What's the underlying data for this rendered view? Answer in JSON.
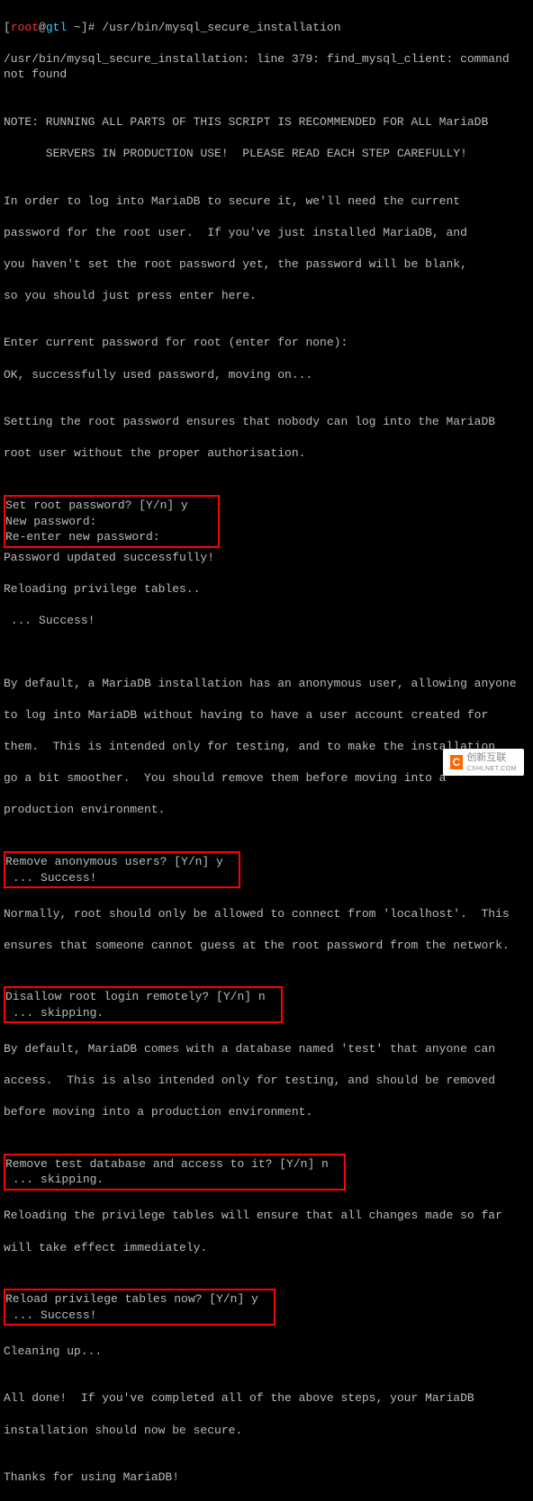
{
  "prompt": {
    "user": "root",
    "at": "@",
    "host": "gtl",
    "path": " ~",
    "suffix": "]# ",
    "command": "/usr/bin/mysql_secure_installation"
  },
  "lines": {
    "l01": "/usr/bin/mysql_secure_installation: line 379: find_mysql_client: command not found",
    "l02": "",
    "l03": "NOTE: RUNNING ALL PARTS OF THIS SCRIPT IS RECOMMENDED FOR ALL MariaDB",
    "l04": "      SERVERS IN PRODUCTION USE!  PLEASE READ EACH STEP CAREFULLY!",
    "l05": "",
    "l06": "In order to log into MariaDB to secure it, we'll need the current",
    "l07": "password for the root user.  If you've just installed MariaDB, and",
    "l08": "you haven't set the root password yet, the password will be blank,",
    "l09": "so you should just press enter here.",
    "l10": "",
    "l11": "Enter current password for root (enter for none):",
    "l12": "OK, successfully used password, moving on...",
    "l13": "",
    "l14": "Setting the root password ensures that nobody can log into the MariaDB",
    "l15": "root user without the proper authorisation.",
    "l16": "",
    "box1_l1": "Set root password? [Y/n] y    ",
    "box1_l2": "New password:                 ",
    "box1_l3": "Re-enter new password:        ",
    "l17": "Password updated successfully!",
    "l18": "Reloading privilege tables..",
    "l19": " ... Success!",
    "l20": "",
    "l21": "",
    "l22": "By default, a MariaDB installation has an anonymous user, allowing anyone",
    "l23": "to log into MariaDB without having to have a user account created for",
    "l24": "them.  This is intended only for testing, and to make the installation",
    "l25": "go a bit smoother.  You should remove them before moving into a",
    "l26": "production environment.",
    "l27": "",
    "box2_l1": "Remove anonymous users? [Y/n] y  ",
    "box2_l2": " ... Success!                    ",
    "l28": "",
    "l29": "Normally, root should only be allowed to connect from 'localhost'.  This",
    "l30": "ensures that someone cannot guess at the root password from the network.",
    "l31": "",
    "box3_l1": "Disallow root login remotely? [Y/n] n  ",
    "box3_l2": " ... skipping.                         ",
    "l32": "",
    "l33": "By default, MariaDB comes with a database named 'test' that anyone can",
    "l34": "access.  This is also intended only for testing, and should be removed",
    "l35": "before moving into a production environment.",
    "l36": "",
    "box4_l1": "Remove test database and access to it? [Y/n] n  ",
    "box4_l2": " ... skipping.                                  ",
    "l37": "",
    "l38": "Reloading the privilege tables will ensure that all changes made so far",
    "l39": "will take effect immediately.",
    "l40": "",
    "box5_l1": "Reload privilege tables now? [Y/n] y  ",
    "box5_l2": " ... Success!                         ",
    "l41": "",
    "l42": "Cleaning up...",
    "l43": "",
    "l44": "All done!  If you've completed all of the above steps, your MariaDB",
    "l45": "installation should now be secure.",
    "l46": "",
    "l47": "Thanks for using MariaDB!"
  },
  "watermark": {
    "logo": "C",
    "text": "创新互联",
    "sub": "CXHLNET.COM"
  }
}
